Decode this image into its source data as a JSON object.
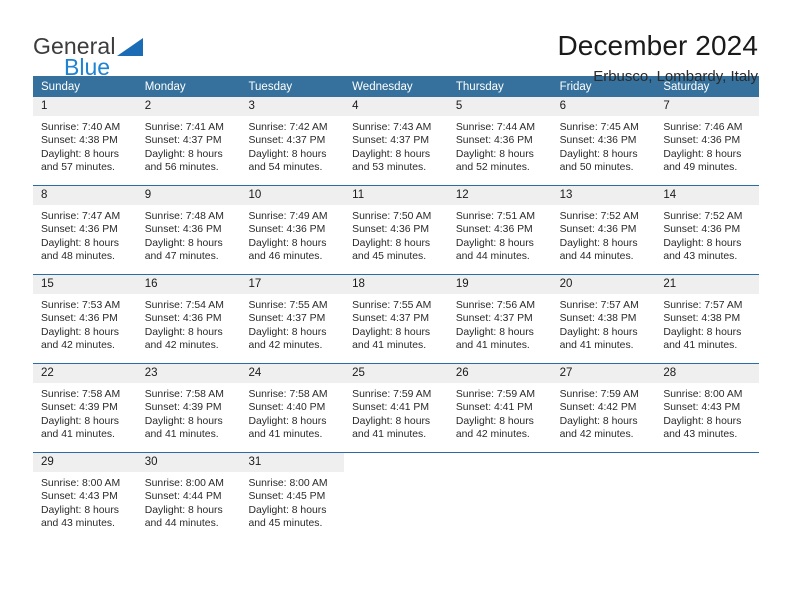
{
  "brand": {
    "name_top": "General",
    "name_bottom": "Blue",
    "flag_color": "#1c6cb5",
    "blue_text_color": "#1f83d4"
  },
  "header": {
    "title": "December 2024",
    "location": "Erbusco, Lombardy, Italy"
  },
  "theme": {
    "header_bg": "#35719c",
    "header_text": "#ffffff",
    "daynum_band_bg": "#efefef",
    "row_separator": "#2a6ca5",
    "cell_bg": "#ffffff",
    "body_text": "#2a2a2a"
  },
  "weekday_headers": [
    "Sunday",
    "Monday",
    "Tuesday",
    "Wednesday",
    "Thursday",
    "Friday",
    "Saturday"
  ],
  "weeks": [
    [
      {
        "day": "1",
        "sunrise": "Sunrise: 7:40 AM",
        "sunset": "Sunset: 4:38 PM",
        "daylight1": "Daylight: 8 hours",
        "daylight2": "and 57 minutes."
      },
      {
        "day": "2",
        "sunrise": "Sunrise: 7:41 AM",
        "sunset": "Sunset: 4:37 PM",
        "daylight1": "Daylight: 8 hours",
        "daylight2": "and 56 minutes."
      },
      {
        "day": "3",
        "sunrise": "Sunrise: 7:42 AM",
        "sunset": "Sunset: 4:37 PM",
        "daylight1": "Daylight: 8 hours",
        "daylight2": "and 54 minutes."
      },
      {
        "day": "4",
        "sunrise": "Sunrise: 7:43 AM",
        "sunset": "Sunset: 4:37 PM",
        "daylight1": "Daylight: 8 hours",
        "daylight2": "and 53 minutes."
      },
      {
        "day": "5",
        "sunrise": "Sunrise: 7:44 AM",
        "sunset": "Sunset: 4:36 PM",
        "daylight1": "Daylight: 8 hours",
        "daylight2": "and 52 minutes."
      },
      {
        "day": "6",
        "sunrise": "Sunrise: 7:45 AM",
        "sunset": "Sunset: 4:36 PM",
        "daylight1": "Daylight: 8 hours",
        "daylight2": "and 50 minutes."
      },
      {
        "day": "7",
        "sunrise": "Sunrise: 7:46 AM",
        "sunset": "Sunset: 4:36 PM",
        "daylight1": "Daylight: 8 hours",
        "daylight2": "and 49 minutes."
      }
    ],
    [
      {
        "day": "8",
        "sunrise": "Sunrise: 7:47 AM",
        "sunset": "Sunset: 4:36 PM",
        "daylight1": "Daylight: 8 hours",
        "daylight2": "and 48 minutes."
      },
      {
        "day": "9",
        "sunrise": "Sunrise: 7:48 AM",
        "sunset": "Sunset: 4:36 PM",
        "daylight1": "Daylight: 8 hours",
        "daylight2": "and 47 minutes."
      },
      {
        "day": "10",
        "sunrise": "Sunrise: 7:49 AM",
        "sunset": "Sunset: 4:36 PM",
        "daylight1": "Daylight: 8 hours",
        "daylight2": "and 46 minutes."
      },
      {
        "day": "11",
        "sunrise": "Sunrise: 7:50 AM",
        "sunset": "Sunset: 4:36 PM",
        "daylight1": "Daylight: 8 hours",
        "daylight2": "and 45 minutes."
      },
      {
        "day": "12",
        "sunrise": "Sunrise: 7:51 AM",
        "sunset": "Sunset: 4:36 PM",
        "daylight1": "Daylight: 8 hours",
        "daylight2": "and 44 minutes."
      },
      {
        "day": "13",
        "sunrise": "Sunrise: 7:52 AM",
        "sunset": "Sunset: 4:36 PM",
        "daylight1": "Daylight: 8 hours",
        "daylight2": "and 44 minutes."
      },
      {
        "day": "14",
        "sunrise": "Sunrise: 7:52 AM",
        "sunset": "Sunset: 4:36 PM",
        "daylight1": "Daylight: 8 hours",
        "daylight2": "and 43 minutes."
      }
    ],
    [
      {
        "day": "15",
        "sunrise": "Sunrise: 7:53 AM",
        "sunset": "Sunset: 4:36 PM",
        "daylight1": "Daylight: 8 hours",
        "daylight2": "and 42 minutes."
      },
      {
        "day": "16",
        "sunrise": "Sunrise: 7:54 AM",
        "sunset": "Sunset: 4:36 PM",
        "daylight1": "Daylight: 8 hours",
        "daylight2": "and 42 minutes."
      },
      {
        "day": "17",
        "sunrise": "Sunrise: 7:55 AM",
        "sunset": "Sunset: 4:37 PM",
        "daylight1": "Daylight: 8 hours",
        "daylight2": "and 42 minutes."
      },
      {
        "day": "18",
        "sunrise": "Sunrise: 7:55 AM",
        "sunset": "Sunset: 4:37 PM",
        "daylight1": "Daylight: 8 hours",
        "daylight2": "and 41 minutes."
      },
      {
        "day": "19",
        "sunrise": "Sunrise: 7:56 AM",
        "sunset": "Sunset: 4:37 PM",
        "daylight1": "Daylight: 8 hours",
        "daylight2": "and 41 minutes."
      },
      {
        "day": "20",
        "sunrise": "Sunrise: 7:57 AM",
        "sunset": "Sunset: 4:38 PM",
        "daylight1": "Daylight: 8 hours",
        "daylight2": "and 41 minutes."
      },
      {
        "day": "21",
        "sunrise": "Sunrise: 7:57 AM",
        "sunset": "Sunset: 4:38 PM",
        "daylight1": "Daylight: 8 hours",
        "daylight2": "and 41 minutes."
      }
    ],
    [
      {
        "day": "22",
        "sunrise": "Sunrise: 7:58 AM",
        "sunset": "Sunset: 4:39 PM",
        "daylight1": "Daylight: 8 hours",
        "daylight2": "and 41 minutes."
      },
      {
        "day": "23",
        "sunrise": "Sunrise: 7:58 AM",
        "sunset": "Sunset: 4:39 PM",
        "daylight1": "Daylight: 8 hours",
        "daylight2": "and 41 minutes."
      },
      {
        "day": "24",
        "sunrise": "Sunrise: 7:58 AM",
        "sunset": "Sunset: 4:40 PM",
        "daylight1": "Daylight: 8 hours",
        "daylight2": "and 41 minutes."
      },
      {
        "day": "25",
        "sunrise": "Sunrise: 7:59 AM",
        "sunset": "Sunset: 4:41 PM",
        "daylight1": "Daylight: 8 hours",
        "daylight2": "and 41 minutes."
      },
      {
        "day": "26",
        "sunrise": "Sunrise: 7:59 AM",
        "sunset": "Sunset: 4:41 PM",
        "daylight1": "Daylight: 8 hours",
        "daylight2": "and 42 minutes."
      },
      {
        "day": "27",
        "sunrise": "Sunrise: 7:59 AM",
        "sunset": "Sunset: 4:42 PM",
        "daylight1": "Daylight: 8 hours",
        "daylight2": "and 42 minutes."
      },
      {
        "day": "28",
        "sunrise": "Sunrise: 8:00 AM",
        "sunset": "Sunset: 4:43 PM",
        "daylight1": "Daylight: 8 hours",
        "daylight2": "and 43 minutes."
      }
    ],
    [
      {
        "day": "29",
        "sunrise": "Sunrise: 8:00 AM",
        "sunset": "Sunset: 4:43 PM",
        "daylight1": "Daylight: 8 hours",
        "daylight2": "and 43 minutes."
      },
      {
        "day": "30",
        "sunrise": "Sunrise: 8:00 AM",
        "sunset": "Sunset: 4:44 PM",
        "daylight1": "Daylight: 8 hours",
        "daylight2": "and 44 minutes."
      },
      {
        "day": "31",
        "sunrise": "Sunrise: 8:00 AM",
        "sunset": "Sunset: 4:45 PM",
        "daylight1": "Daylight: 8 hours",
        "daylight2": "and 45 minutes."
      },
      {
        "day": "",
        "sunrise": "",
        "sunset": "",
        "daylight1": "",
        "daylight2": ""
      },
      {
        "day": "",
        "sunrise": "",
        "sunset": "",
        "daylight1": "",
        "daylight2": ""
      },
      {
        "day": "",
        "sunrise": "",
        "sunset": "",
        "daylight1": "",
        "daylight2": ""
      },
      {
        "day": "",
        "sunrise": "",
        "sunset": "",
        "daylight1": "",
        "daylight2": ""
      }
    ]
  ]
}
